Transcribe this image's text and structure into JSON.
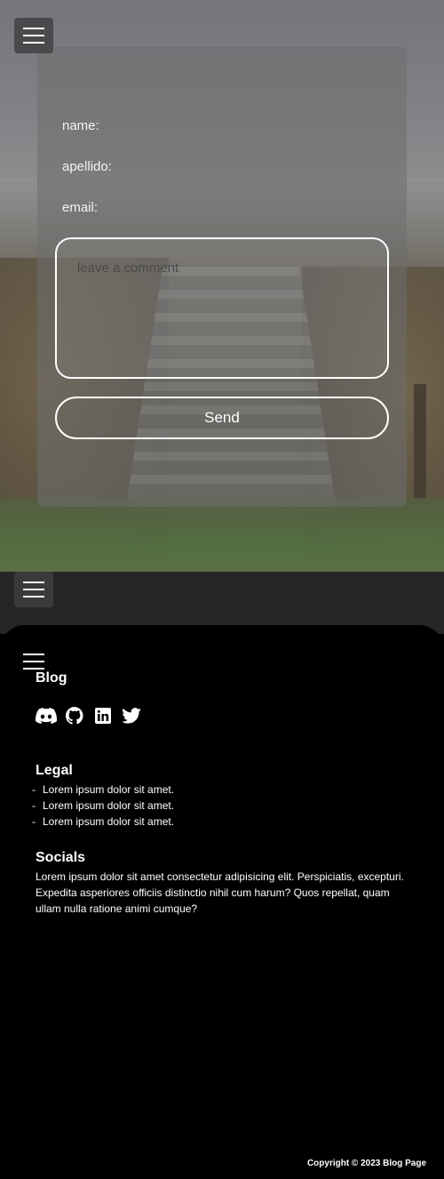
{
  "form": {
    "name_label": "name:",
    "surname_label": "apellido:",
    "email_label": "email:",
    "comment_placeholder": "leave a comment",
    "send_label": "Send"
  },
  "footer": {
    "blog_title": "Blog",
    "social_icons": [
      "discord-icon",
      "github-icon",
      "linkedin-icon",
      "twitter-icon"
    ],
    "legal_title": "Legal",
    "legal_items": [
      "Lorem ipsum dolor sit amet.",
      "Lorem ipsum dolor sit amet.",
      "Lorem ipsum dolor sit amet."
    ],
    "socials_title": "Socials",
    "socials_text": "Lorem ipsum dolor sit amet consectetur adipisicing elit. Perspiciatis, excepturi. Expedita asperiores officiis distinctio nihil cum harum? Quos repellat, quam ullam nulla ratione animi cumque?",
    "copyright": "Copyright © 2023 Blog Page"
  },
  "colors": {
    "page_background": "#000000",
    "strip": "#262626",
    "form_card": "rgba(110,110,110,0.55)",
    "text": "#ffffff"
  }
}
